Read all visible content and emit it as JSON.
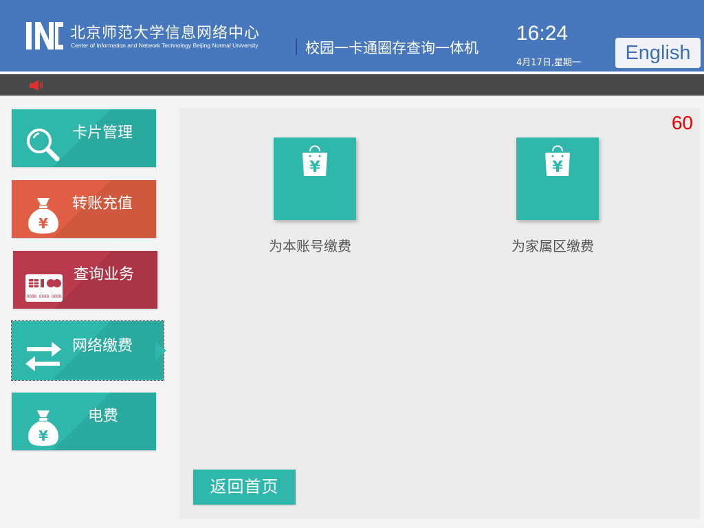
{
  "header": {
    "logo_text": "INC",
    "org_name": "北京师范大学信息网络中心",
    "org_subtitle": "Center of Information and Network Technology Beijing Normal University",
    "system_name": "校园一卡通圈存查询一体机",
    "time": "16:24",
    "date": "4月17日,星期一",
    "language_button": "English",
    "brand_color": "#4778bd"
  },
  "notice_bar": {
    "icon": "speaker-icon",
    "icon_color": "#e03030"
  },
  "sidebar": {
    "items": [
      {
        "label": "卡片管理",
        "icon": "magnifier-icon",
        "color": "#2eb7aa"
      },
      {
        "label": "转账充值",
        "icon": "money-bag-icon",
        "color": "#e05f44"
      },
      {
        "label": "查询业务",
        "icon": "bank-card-icon",
        "color": "#b83a4c",
        "card_number_text": "8888 8888 8888"
      },
      {
        "label": "网络缴费",
        "icon": "transfer-arrows-icon",
        "color": "#2eb7aa",
        "selected": true
      },
      {
        "label": "电费",
        "icon": "money-bag-icon",
        "color": "#2eb7aa"
      }
    ]
  },
  "main": {
    "countdown": "60",
    "options": [
      {
        "label": "为本账号缴费",
        "icon": "shopping-bag-yuan-icon",
        "glyph": "¥"
      },
      {
        "label": "为家属区缴费",
        "icon": "shopping-bag-yuan-icon",
        "glyph": "¥"
      }
    ],
    "back_button": "返回首页"
  }
}
